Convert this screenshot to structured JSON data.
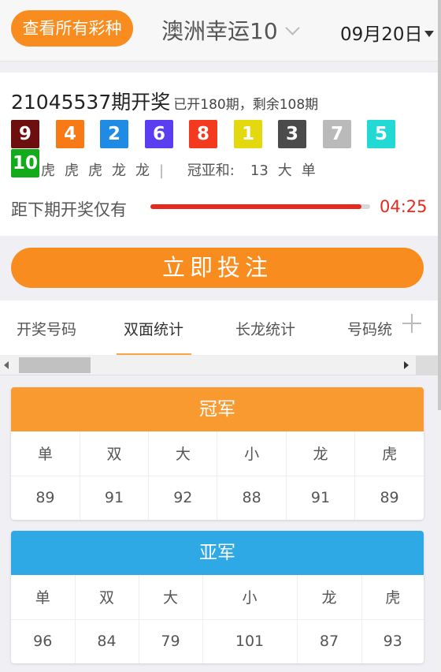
{
  "header": {
    "all_button": "查看所有彩种",
    "title": "澳洲幸运10",
    "date": "09月20日"
  },
  "draw": {
    "issue": "21045537期开奖",
    "issue_sub": "已开180期，剩余108期",
    "balls": [
      {
        "num": "9",
        "color": "#6e0f0f"
      },
      {
        "num": "4",
        "color": "#f87a16"
      },
      {
        "num": "2",
        "color": "#1f8be4"
      },
      {
        "num": "6",
        "color": "#5b3ef0"
      },
      {
        "num": "8",
        "color": "#f33a1f"
      },
      {
        "num": "1",
        "color": "#e4d90e"
      },
      {
        "num": "3",
        "color": "#4b4b4b"
      },
      {
        "num": "7",
        "color": "#bababa"
      },
      {
        "num": "5",
        "color": "#22d9d4"
      },
      {
        "num": "10",
        "color": "#12ab1c"
      }
    ],
    "dragon_tiger": [
      "虎",
      "虎",
      "虎",
      "龙",
      "龙"
    ],
    "sum_label": "冠亚和:",
    "sum_value": "13",
    "sum_size": "大",
    "sum_parity": "单",
    "countdown_label": "距下期开奖仅有",
    "countdown_progress": 0.96,
    "countdown_time": "04:25"
  },
  "bet_button": "立即投注",
  "tabs": [
    {
      "label": "开奖号码"
    },
    {
      "label": "双面统计"
    },
    {
      "label": "长龙统计"
    },
    {
      "label": "号码统"
    }
  ],
  "cards": [
    {
      "title": "冠军",
      "color": "#f99a31",
      "headers": [
        "单",
        "双",
        "大",
        "小",
        "龙",
        "虎"
      ],
      "values": [
        "89",
        "91",
        "92",
        "88",
        "91",
        "89"
      ]
    },
    {
      "title": "亚军",
      "color": "#2fa8e6",
      "headers": [
        "单",
        "双",
        "大",
        "小",
        "龙",
        "虎"
      ],
      "values": [
        "96",
        "84",
        "79",
        "101",
        "87",
        "93"
      ]
    }
  ]
}
